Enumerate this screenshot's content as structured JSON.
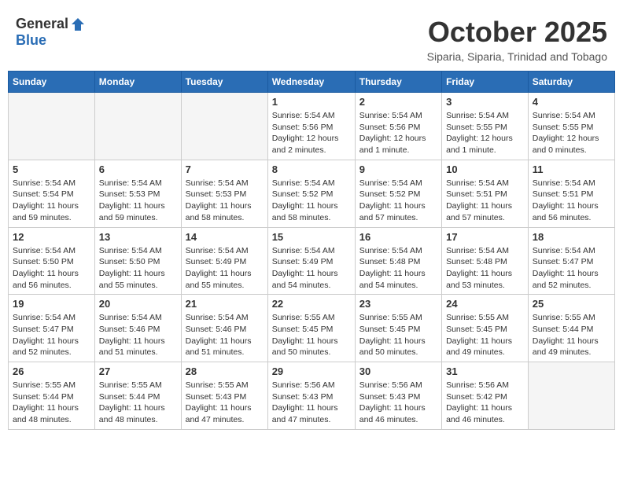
{
  "header": {
    "logo_general": "General",
    "logo_blue": "Blue",
    "month": "October 2025",
    "location": "Siparia, Siparia, Trinidad and Tobago"
  },
  "days_of_week": [
    "Sunday",
    "Monday",
    "Tuesday",
    "Wednesday",
    "Thursday",
    "Friday",
    "Saturday"
  ],
  "weeks": [
    [
      {
        "day": "",
        "sunrise": "",
        "sunset": "",
        "daylight": ""
      },
      {
        "day": "",
        "sunrise": "",
        "sunset": "",
        "daylight": ""
      },
      {
        "day": "",
        "sunrise": "",
        "sunset": "",
        "daylight": ""
      },
      {
        "day": "1",
        "sunrise": "Sunrise: 5:54 AM",
        "sunset": "Sunset: 5:56 PM",
        "daylight": "Daylight: 12 hours and 2 minutes."
      },
      {
        "day": "2",
        "sunrise": "Sunrise: 5:54 AM",
        "sunset": "Sunset: 5:56 PM",
        "daylight": "Daylight: 12 hours and 1 minute."
      },
      {
        "day": "3",
        "sunrise": "Sunrise: 5:54 AM",
        "sunset": "Sunset: 5:55 PM",
        "daylight": "Daylight: 12 hours and 1 minute."
      },
      {
        "day": "4",
        "sunrise": "Sunrise: 5:54 AM",
        "sunset": "Sunset: 5:55 PM",
        "daylight": "Daylight: 12 hours and 0 minutes."
      }
    ],
    [
      {
        "day": "5",
        "sunrise": "Sunrise: 5:54 AM",
        "sunset": "Sunset: 5:54 PM",
        "daylight": "Daylight: 11 hours and 59 minutes."
      },
      {
        "day": "6",
        "sunrise": "Sunrise: 5:54 AM",
        "sunset": "Sunset: 5:53 PM",
        "daylight": "Daylight: 11 hours and 59 minutes."
      },
      {
        "day": "7",
        "sunrise": "Sunrise: 5:54 AM",
        "sunset": "Sunset: 5:53 PM",
        "daylight": "Daylight: 11 hours and 58 minutes."
      },
      {
        "day": "8",
        "sunrise": "Sunrise: 5:54 AM",
        "sunset": "Sunset: 5:52 PM",
        "daylight": "Daylight: 11 hours and 58 minutes."
      },
      {
        "day": "9",
        "sunrise": "Sunrise: 5:54 AM",
        "sunset": "Sunset: 5:52 PM",
        "daylight": "Daylight: 11 hours and 57 minutes."
      },
      {
        "day": "10",
        "sunrise": "Sunrise: 5:54 AM",
        "sunset": "Sunset: 5:51 PM",
        "daylight": "Daylight: 11 hours and 57 minutes."
      },
      {
        "day": "11",
        "sunrise": "Sunrise: 5:54 AM",
        "sunset": "Sunset: 5:51 PM",
        "daylight": "Daylight: 11 hours and 56 minutes."
      }
    ],
    [
      {
        "day": "12",
        "sunrise": "Sunrise: 5:54 AM",
        "sunset": "Sunset: 5:50 PM",
        "daylight": "Daylight: 11 hours and 56 minutes."
      },
      {
        "day": "13",
        "sunrise": "Sunrise: 5:54 AM",
        "sunset": "Sunset: 5:50 PM",
        "daylight": "Daylight: 11 hours and 55 minutes."
      },
      {
        "day": "14",
        "sunrise": "Sunrise: 5:54 AM",
        "sunset": "Sunset: 5:49 PM",
        "daylight": "Daylight: 11 hours and 55 minutes."
      },
      {
        "day": "15",
        "sunrise": "Sunrise: 5:54 AM",
        "sunset": "Sunset: 5:49 PM",
        "daylight": "Daylight: 11 hours and 54 minutes."
      },
      {
        "day": "16",
        "sunrise": "Sunrise: 5:54 AM",
        "sunset": "Sunset: 5:48 PM",
        "daylight": "Daylight: 11 hours and 54 minutes."
      },
      {
        "day": "17",
        "sunrise": "Sunrise: 5:54 AM",
        "sunset": "Sunset: 5:48 PM",
        "daylight": "Daylight: 11 hours and 53 minutes."
      },
      {
        "day": "18",
        "sunrise": "Sunrise: 5:54 AM",
        "sunset": "Sunset: 5:47 PM",
        "daylight": "Daylight: 11 hours and 52 minutes."
      }
    ],
    [
      {
        "day": "19",
        "sunrise": "Sunrise: 5:54 AM",
        "sunset": "Sunset: 5:47 PM",
        "daylight": "Daylight: 11 hours and 52 minutes."
      },
      {
        "day": "20",
        "sunrise": "Sunrise: 5:54 AM",
        "sunset": "Sunset: 5:46 PM",
        "daylight": "Daylight: 11 hours and 51 minutes."
      },
      {
        "day": "21",
        "sunrise": "Sunrise: 5:54 AM",
        "sunset": "Sunset: 5:46 PM",
        "daylight": "Daylight: 11 hours and 51 minutes."
      },
      {
        "day": "22",
        "sunrise": "Sunrise: 5:55 AM",
        "sunset": "Sunset: 5:45 PM",
        "daylight": "Daylight: 11 hours and 50 minutes."
      },
      {
        "day": "23",
        "sunrise": "Sunrise: 5:55 AM",
        "sunset": "Sunset: 5:45 PM",
        "daylight": "Daylight: 11 hours and 50 minutes."
      },
      {
        "day": "24",
        "sunrise": "Sunrise: 5:55 AM",
        "sunset": "Sunset: 5:45 PM",
        "daylight": "Daylight: 11 hours and 49 minutes."
      },
      {
        "day": "25",
        "sunrise": "Sunrise: 5:55 AM",
        "sunset": "Sunset: 5:44 PM",
        "daylight": "Daylight: 11 hours and 49 minutes."
      }
    ],
    [
      {
        "day": "26",
        "sunrise": "Sunrise: 5:55 AM",
        "sunset": "Sunset: 5:44 PM",
        "daylight": "Daylight: 11 hours and 48 minutes."
      },
      {
        "day": "27",
        "sunrise": "Sunrise: 5:55 AM",
        "sunset": "Sunset: 5:44 PM",
        "daylight": "Daylight: 11 hours and 48 minutes."
      },
      {
        "day": "28",
        "sunrise": "Sunrise: 5:55 AM",
        "sunset": "Sunset: 5:43 PM",
        "daylight": "Daylight: 11 hours and 47 minutes."
      },
      {
        "day": "29",
        "sunrise": "Sunrise: 5:56 AM",
        "sunset": "Sunset: 5:43 PM",
        "daylight": "Daylight: 11 hours and 47 minutes."
      },
      {
        "day": "30",
        "sunrise": "Sunrise: 5:56 AM",
        "sunset": "Sunset: 5:43 PM",
        "daylight": "Daylight: 11 hours and 46 minutes."
      },
      {
        "day": "31",
        "sunrise": "Sunrise: 5:56 AM",
        "sunset": "Sunset: 5:42 PM",
        "daylight": "Daylight: 11 hours and 46 minutes."
      },
      {
        "day": "",
        "sunrise": "",
        "sunset": "",
        "daylight": ""
      }
    ]
  ]
}
